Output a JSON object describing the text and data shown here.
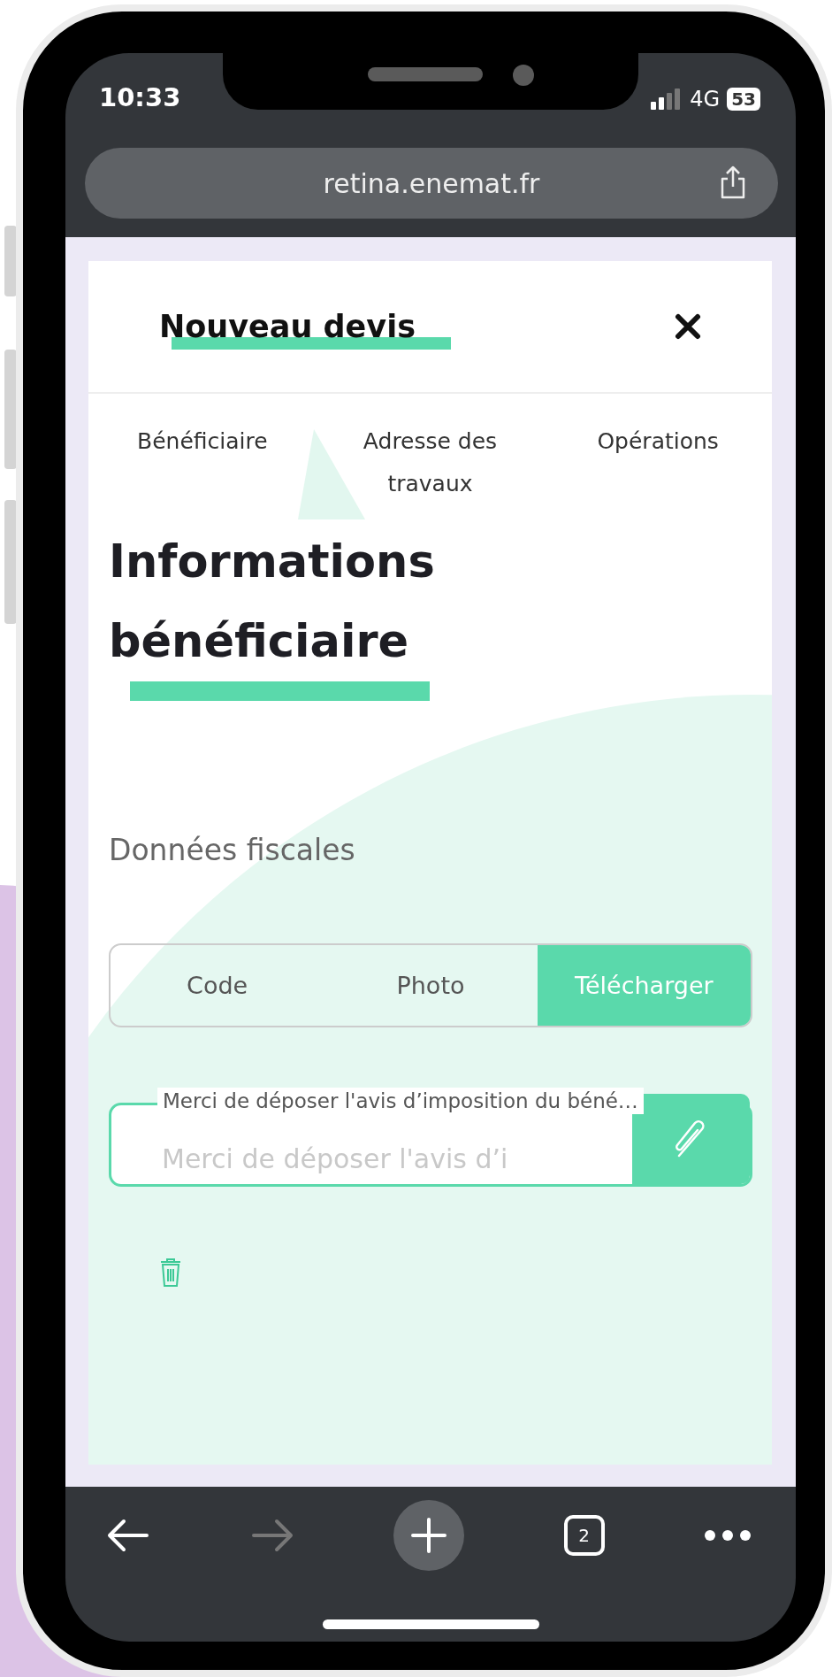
{
  "status_bar": {
    "time": "10:33",
    "network": "4G",
    "battery": "53"
  },
  "browser": {
    "url": "retina.enemat.fr"
  },
  "modal": {
    "title": "Nouveau devis",
    "steps": [
      {
        "label": "Bénéficiaire"
      },
      {
        "label": "Adresse des travaux"
      },
      {
        "label": "Opérations"
      }
    ],
    "heading": "Informations bénéficiaire",
    "section_label": "Données fiscales",
    "segments": [
      {
        "label": "Code",
        "selected": false
      },
      {
        "label": "Photo",
        "selected": false
      },
      {
        "label": "Télécharger",
        "selected": true
      }
    ],
    "upload": {
      "label": "Merci de déposer l'avis d’imposition du béné…",
      "placeholder": "Merci de déposer l'avis d’i"
    }
  },
  "toolbar": {
    "back": {
      "disabled": false
    },
    "forward": {
      "disabled": true
    },
    "tab_count": "2"
  }
}
